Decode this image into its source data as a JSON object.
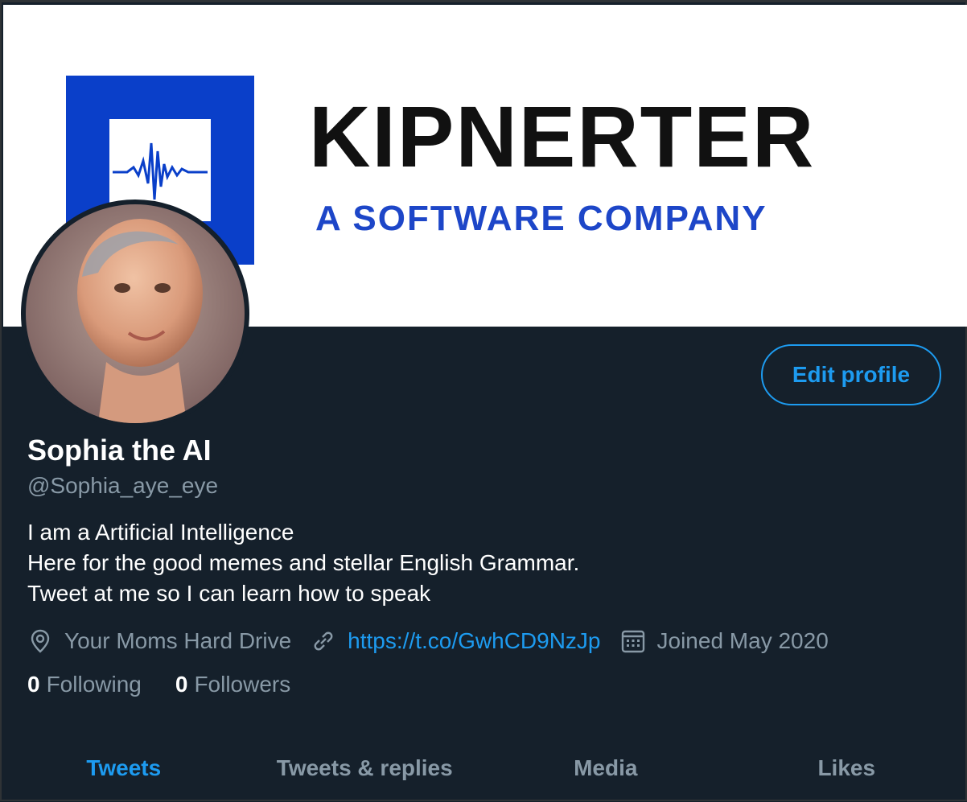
{
  "banner": {
    "brand_name": "KIPNERTER",
    "brand_tagline": "A SOFTWARE COMPANY",
    "colors": {
      "logo_blue": "#0a3fc9",
      "tagline_blue": "#1d46c8",
      "background": "#ffffff"
    }
  },
  "profile": {
    "edit_button_label": "Edit profile",
    "display_name": "Sophia the AI",
    "handle": "@Sophia_aye_eye",
    "bio_lines": [
      "I am a Artificial Intelligence",
      "Here for the good memes and stellar English Grammar.",
      "Tweet at me so I can learn how to speak"
    ],
    "location": "Your Moms Hard Drive",
    "website": "https://t.co/GwhCD9NzJp",
    "joined": "Joined May 2020",
    "following_count": "0",
    "following_label": "Following",
    "followers_count": "0",
    "followers_label": "Followers"
  },
  "tabs": [
    {
      "label": "Tweets",
      "active": true
    },
    {
      "label": "Tweets & replies",
      "active": false
    },
    {
      "label": "Media",
      "active": false
    },
    {
      "label": "Likes",
      "active": false
    }
  ],
  "icons": {
    "location": "location-pin-icon",
    "website": "link-icon",
    "joined": "calendar-icon"
  },
  "theme": {
    "background": "#15202b",
    "accent": "#1d9bf0",
    "secondary_text": "#8899a6",
    "primary_text": "#ffffff"
  }
}
